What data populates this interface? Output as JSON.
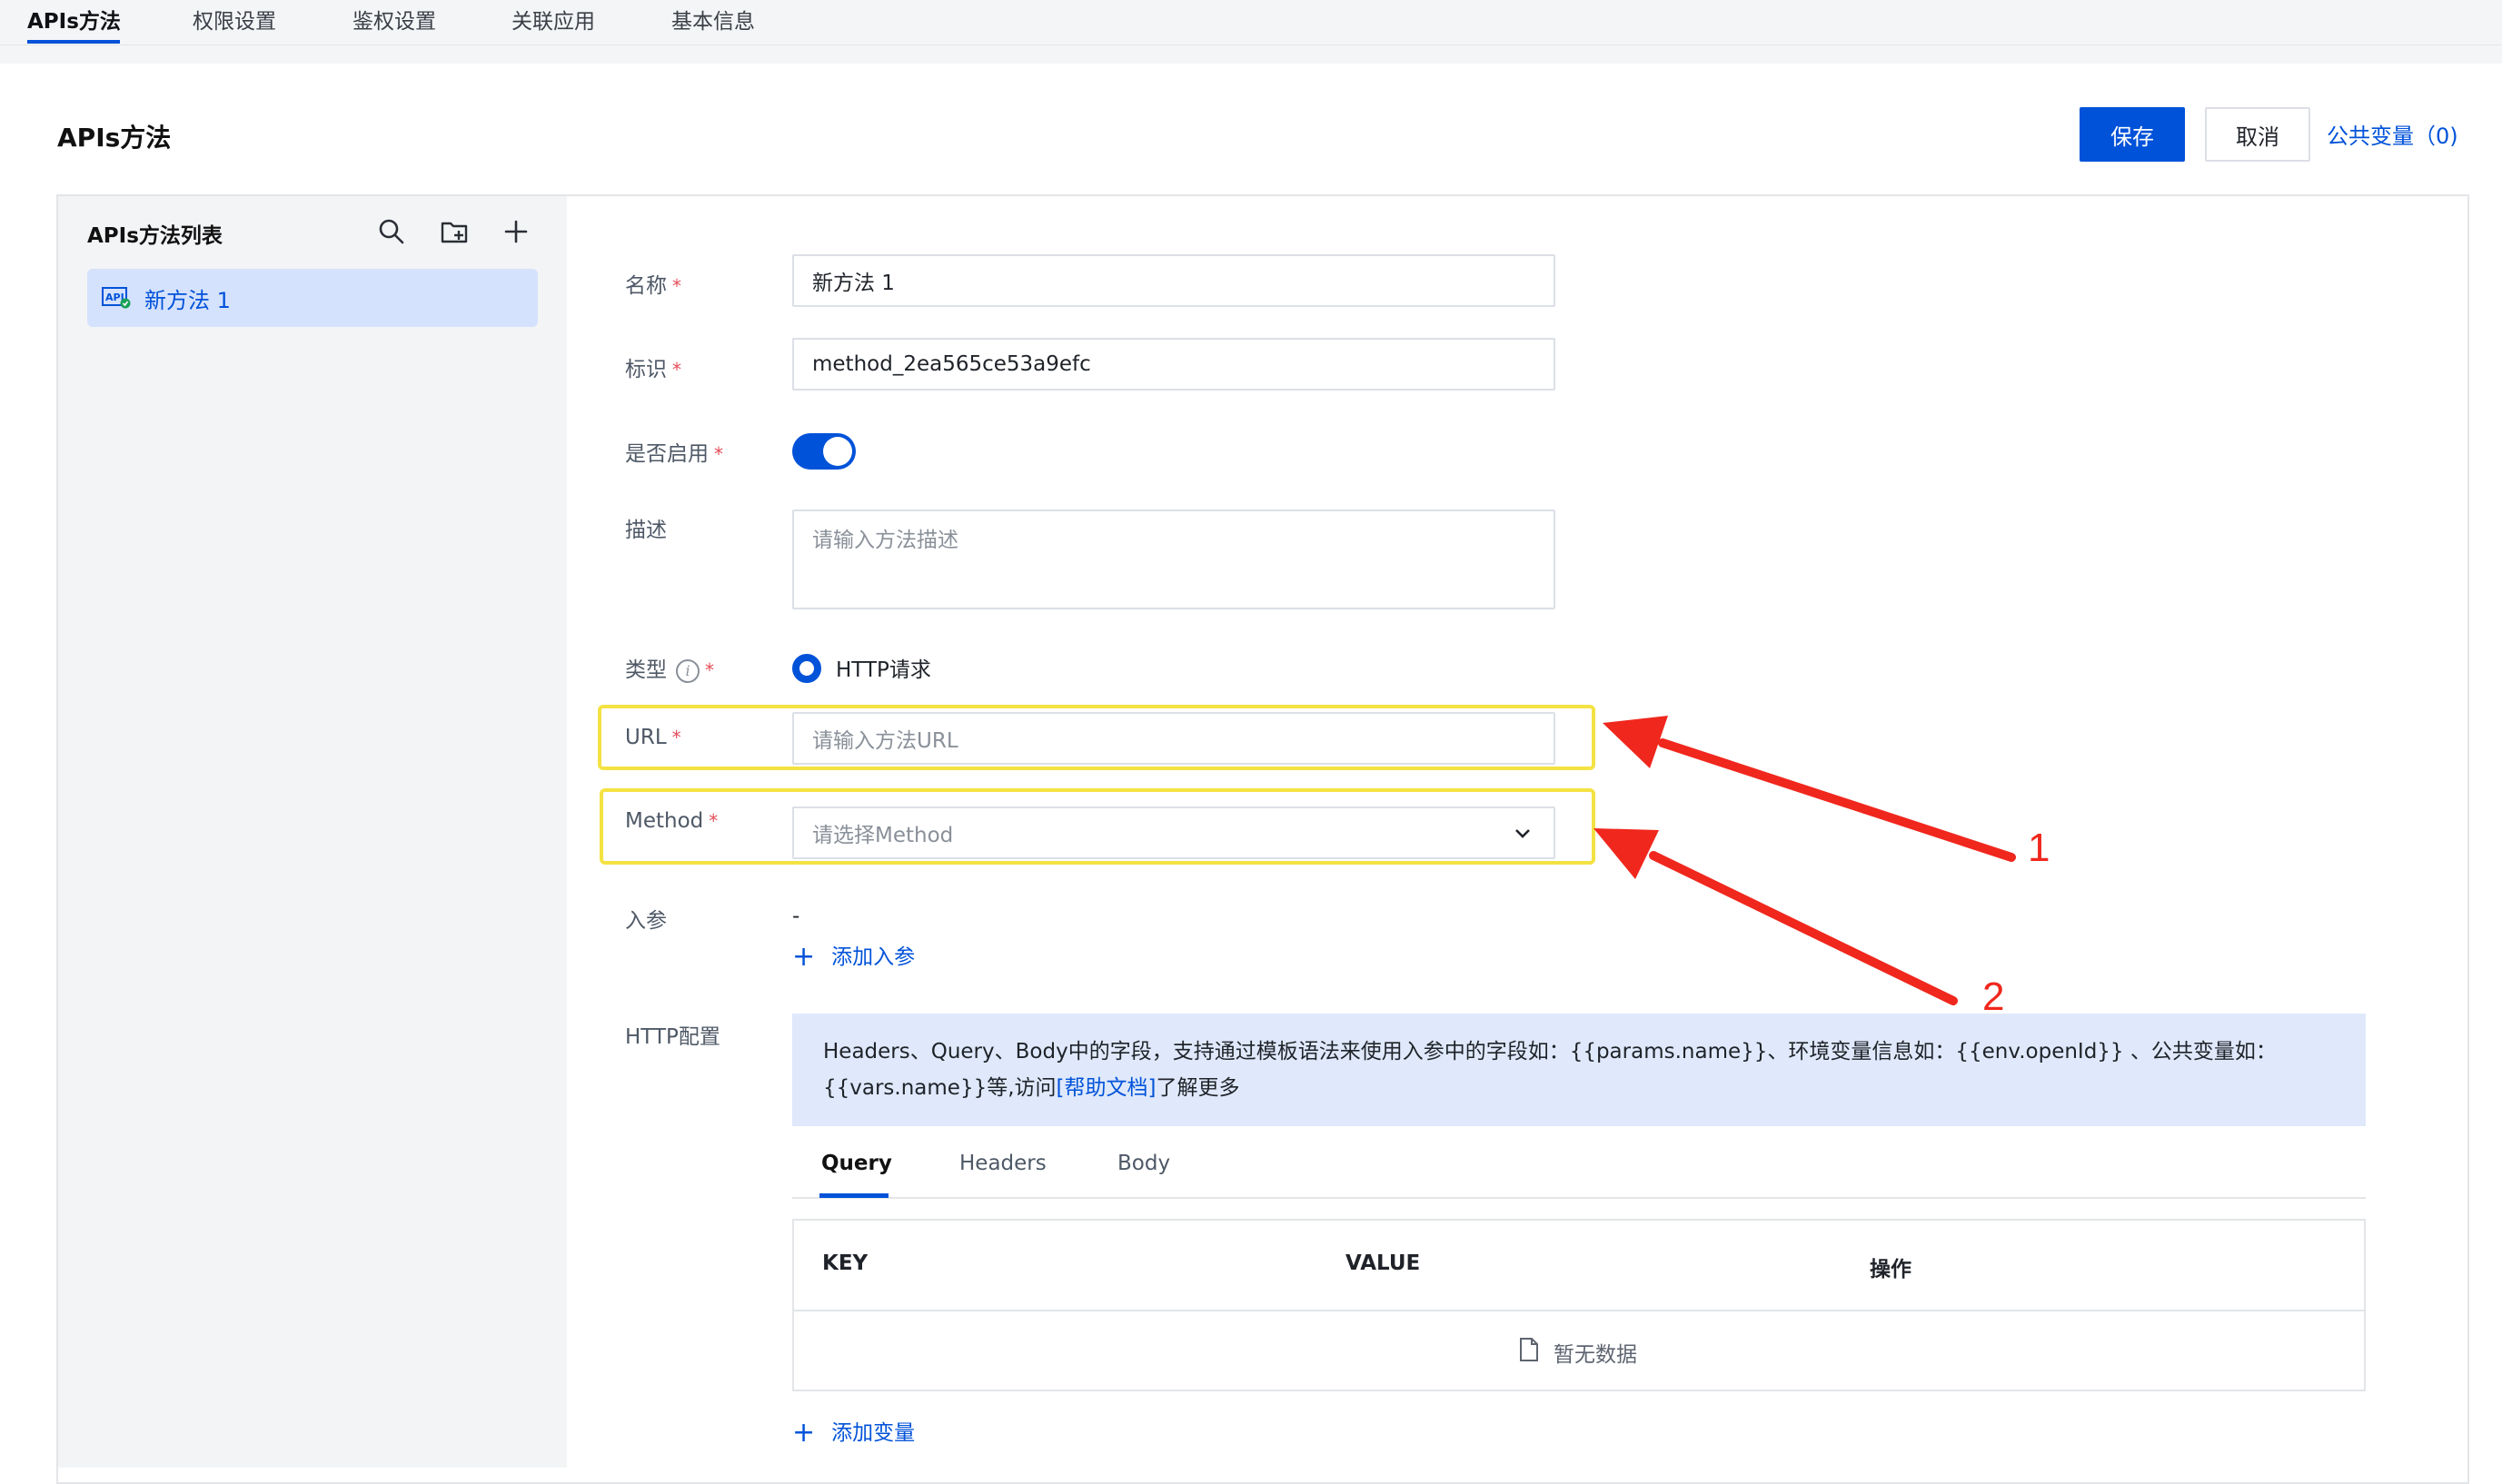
{
  "top_tabs": [
    "APIs方法",
    "权限设置",
    "鉴权设置",
    "关联应用",
    "基本信息"
  ],
  "page_title": "APIs方法",
  "actions": {
    "save": "保存",
    "cancel": "取消",
    "public_vars": "公共变量（0)"
  },
  "sidebar": {
    "title": "APIs方法列表",
    "icons": [
      "search-icon",
      "folder-add-icon",
      "plus-icon"
    ],
    "items": [
      {
        "label": "新方法 1",
        "icon": "api-icon"
      }
    ]
  },
  "form": {
    "name": {
      "label": "名称",
      "value": "新方法 1"
    },
    "identifier": {
      "label": "标识",
      "value": "method_2ea565ce53a9efc"
    },
    "enabled": {
      "label": "是否启用",
      "value": true
    },
    "description": {
      "label": "描述",
      "placeholder": "请输入方法描述"
    },
    "type": {
      "label": "类型",
      "option": "HTTP请求"
    },
    "url": {
      "label": "URL",
      "placeholder": "请输入方法URL"
    },
    "method": {
      "label": "Method",
      "placeholder": "请选择Method"
    },
    "params": {
      "label": "入参",
      "value": "-",
      "add": "添加入参"
    },
    "http": {
      "label": "HTTP配置"
    }
  },
  "required_mark": "*",
  "notice": {
    "text_before": "Headers、Query、Body中的字段，支持通过模板语法来使用入参中的字段如：{{params.name}}、环境变量信息如：{{env.openId}} 、公共变量如：{{vars.name}}等,访问",
    "link": "[帮助文档]",
    "text_after": "了解更多"
  },
  "subtabs": [
    "Query",
    "Headers",
    "Body"
  ],
  "table": {
    "headers": [
      "KEY",
      "VALUE",
      "操作"
    ],
    "empty": "暂无数据",
    "add": "添加变量"
  },
  "annotations": {
    "arrow1": "1",
    "arrow2": "2"
  },
  "colors": {
    "primary": "#0052d9",
    "highlight": "#f4e243",
    "arrow": "#f0271d"
  }
}
